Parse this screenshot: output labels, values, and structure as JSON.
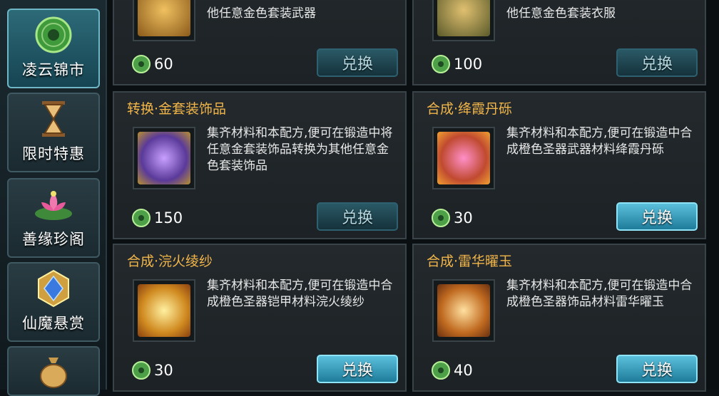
{
  "sidebar": {
    "tabs": [
      {
        "label": "凌云锦市",
        "active": true,
        "icon": "jade-coin-icon"
      },
      {
        "label": "限时特惠",
        "active": false,
        "icon": "hourglass-icon"
      },
      {
        "label": "善缘珍阁",
        "active": false,
        "icon": "lotus-icon"
      },
      {
        "label": "仙魔悬赏",
        "active": false,
        "icon": "crystal-badge-icon"
      },
      {
        "label": "",
        "active": false,
        "icon": "money-bag-icon"
      }
    ]
  },
  "cards": [
    {
      "title": "",
      "desc_tail": "他任意金色套装武器",
      "price": "60",
      "button": "兑换",
      "button_active": false,
      "art": "#8a5a1a"
    },
    {
      "title": "",
      "desc_tail": "他任意金色套装衣服",
      "price": "100",
      "button": "兑换",
      "button_active": false,
      "art": "#5a5a2a"
    },
    {
      "title": "转换·金套装饰品",
      "desc": "集齐材料和本配方,便可在锻造中将任意金套装饰品转换为其他任意金色套装饰品",
      "price": "150",
      "button": "兑换",
      "button_active": false,
      "art": "#5a3a9a"
    },
    {
      "title": "合成·绛霞丹砾",
      "desc": "集齐材料和本配方,便可在锻造中合成橙色圣器武器材料绛霞丹砾",
      "price": "30",
      "button": "兑换",
      "button_active": true,
      "art": "#c04a30"
    },
    {
      "title": "合成·浣火绫纱",
      "desc": "集齐材料和本配方,便可在锻造中合成橙色圣器铠甲材料浣火绫纱",
      "price": "30",
      "button": "兑换",
      "button_active": true,
      "art": "#d08a20"
    },
    {
      "title": "合成·雷华曜玉",
      "desc": "集齐材料和本配方,便可在锻造中合成橙色圣器饰品材料雷华曜玉",
      "price": "40",
      "button": "兑换",
      "button_active": true,
      "art": "#c06a20"
    }
  ],
  "colors": {
    "title": "#f2b54a",
    "accent": "#5bc0dc",
    "jade": "#6fbf5a"
  }
}
